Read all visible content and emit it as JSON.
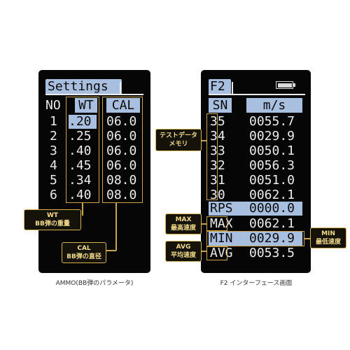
{
  "left_screen": {
    "header": "Settings",
    "columns": [
      "NO",
      "WT",
      "CAL"
    ],
    "rows": [
      {
        "no": "1",
        "wt": ".20",
        "cal": "06.0"
      },
      {
        "no": "2",
        "wt": ".25",
        "cal": "06.0"
      },
      {
        "no": "3",
        "wt": ".40",
        "cal": "06.0"
      },
      {
        "no": "4",
        "wt": ".45",
        "cal": "06.0"
      },
      {
        "no": "5",
        "wt": ".34",
        "cal": "08.0"
      },
      {
        "no": "6",
        "wt": ".40",
        "cal": "08.0"
      }
    ],
    "caption": "AMMO(BB弾のパラメータ)"
  },
  "right_screen": {
    "header": "F2",
    "columns": [
      "SN",
      "m/s"
    ],
    "rows": [
      {
        "sn": "35",
        "val": "0055.7"
      },
      {
        "sn": "34",
        "val": "0029.9"
      },
      {
        "sn": "33",
        "val": "0050.1"
      },
      {
        "sn": "32",
        "val": "0056.3"
      },
      {
        "sn": "31",
        "val": "0051.0"
      },
      {
        "sn": "30",
        "val": "0062.1"
      }
    ],
    "stats": [
      {
        "label": "RPS",
        "val": "0000.0"
      },
      {
        "label": "MAX",
        "val": "0062.1"
      },
      {
        "label": "MIN",
        "val": "0029.9"
      },
      {
        "label": "AVG",
        "val": "0053.5"
      }
    ],
    "caption": "F2 インターフェース画面"
  },
  "callouts": {
    "wt": {
      "line1": "WT",
      "line2": "BB弾の重量"
    },
    "cal": {
      "line1": "CAL",
      "line2": "BB弾の直径"
    },
    "memory": {
      "line1": "テストデータ",
      "line2": "メモリ"
    },
    "max": {
      "line1": "MAX",
      "line2": "最高速度"
    },
    "avg": {
      "line1": "AVG",
      "line2": "平均速度"
    },
    "min": {
      "line1": "MIN",
      "line2": "最低速度"
    }
  },
  "colors": {
    "highlight": "#a9bfe0",
    "callout_border": "#d4b24c",
    "callout_text": "#f4dd8a"
  }
}
